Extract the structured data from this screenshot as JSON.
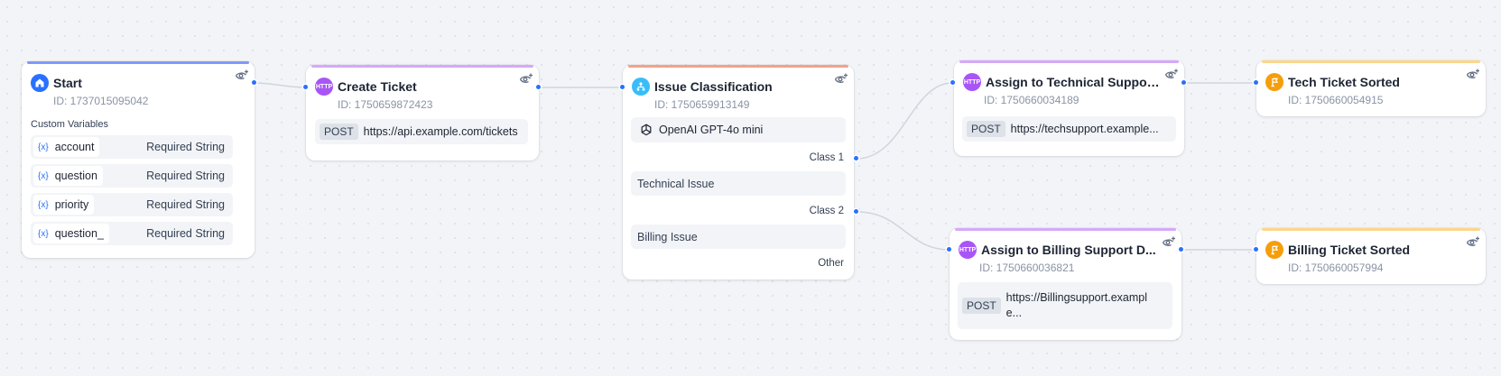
{
  "nodes": {
    "start": {
      "title": "Start",
      "id": "ID: 1737015095042",
      "section_label": "Custom Variables",
      "variables": [
        {
          "name": "account",
          "type": "Required String"
        },
        {
          "name": "question",
          "type": "Required String"
        },
        {
          "name": "priority",
          "type": "Required String"
        },
        {
          "name": "question_",
          "type": "Required String"
        }
      ]
    },
    "create_ticket": {
      "title": "Create Ticket",
      "id": "ID: 1750659872423",
      "icon_text": "HTTP",
      "method": "POST",
      "url": "https://api.example.com/tickets"
    },
    "issue_classification": {
      "title": "Issue Classification",
      "id": "ID: 1750659913149",
      "model": "OpenAI GPT-4o mini",
      "class1_label": "Class 1",
      "class1_value": "Technical Issue",
      "class2_label": "Class 2",
      "class2_value": "Billing Issue",
      "other_label": "Other"
    },
    "assign_technical": {
      "title": "Assign to Technical Support...",
      "id": "ID: 1750660034189",
      "icon_text": "HTTP",
      "method": "POST",
      "url": "https://techsupport.example..."
    },
    "assign_billing": {
      "title": "Assign to Billing Support D...",
      "id": "ID: 1750660036821",
      "icon_text": "HTTP",
      "method": "POST",
      "url": "https://Billingsupport.example..."
    },
    "tech_sorted": {
      "title": "Tech Ticket Sorted",
      "id": "ID: 1750660054915"
    },
    "billing_sorted": {
      "title": "Billing Ticket Sorted",
      "id": "ID: 1750660057994"
    }
  },
  "icons": {
    "start": "home-icon",
    "http": "http-icon",
    "classifier": "classifier-icon",
    "end": "flag-icon",
    "model": "openai-icon",
    "preview": "eye-plus-icon",
    "variable": "variable-icon"
  },
  "colors": {
    "start_bar": "#8098f9",
    "http_bar": "#d6a8fa",
    "classifier_bar": "#f4a08b",
    "end_bar": "#fdd68a",
    "start_icon": "#2970ff",
    "http_icon": "#a855f7",
    "classifier_icon": "#38bdf8",
    "end_icon": "#f59e0b",
    "handle": "#2970ff",
    "edge": "#d0d5dd"
  }
}
